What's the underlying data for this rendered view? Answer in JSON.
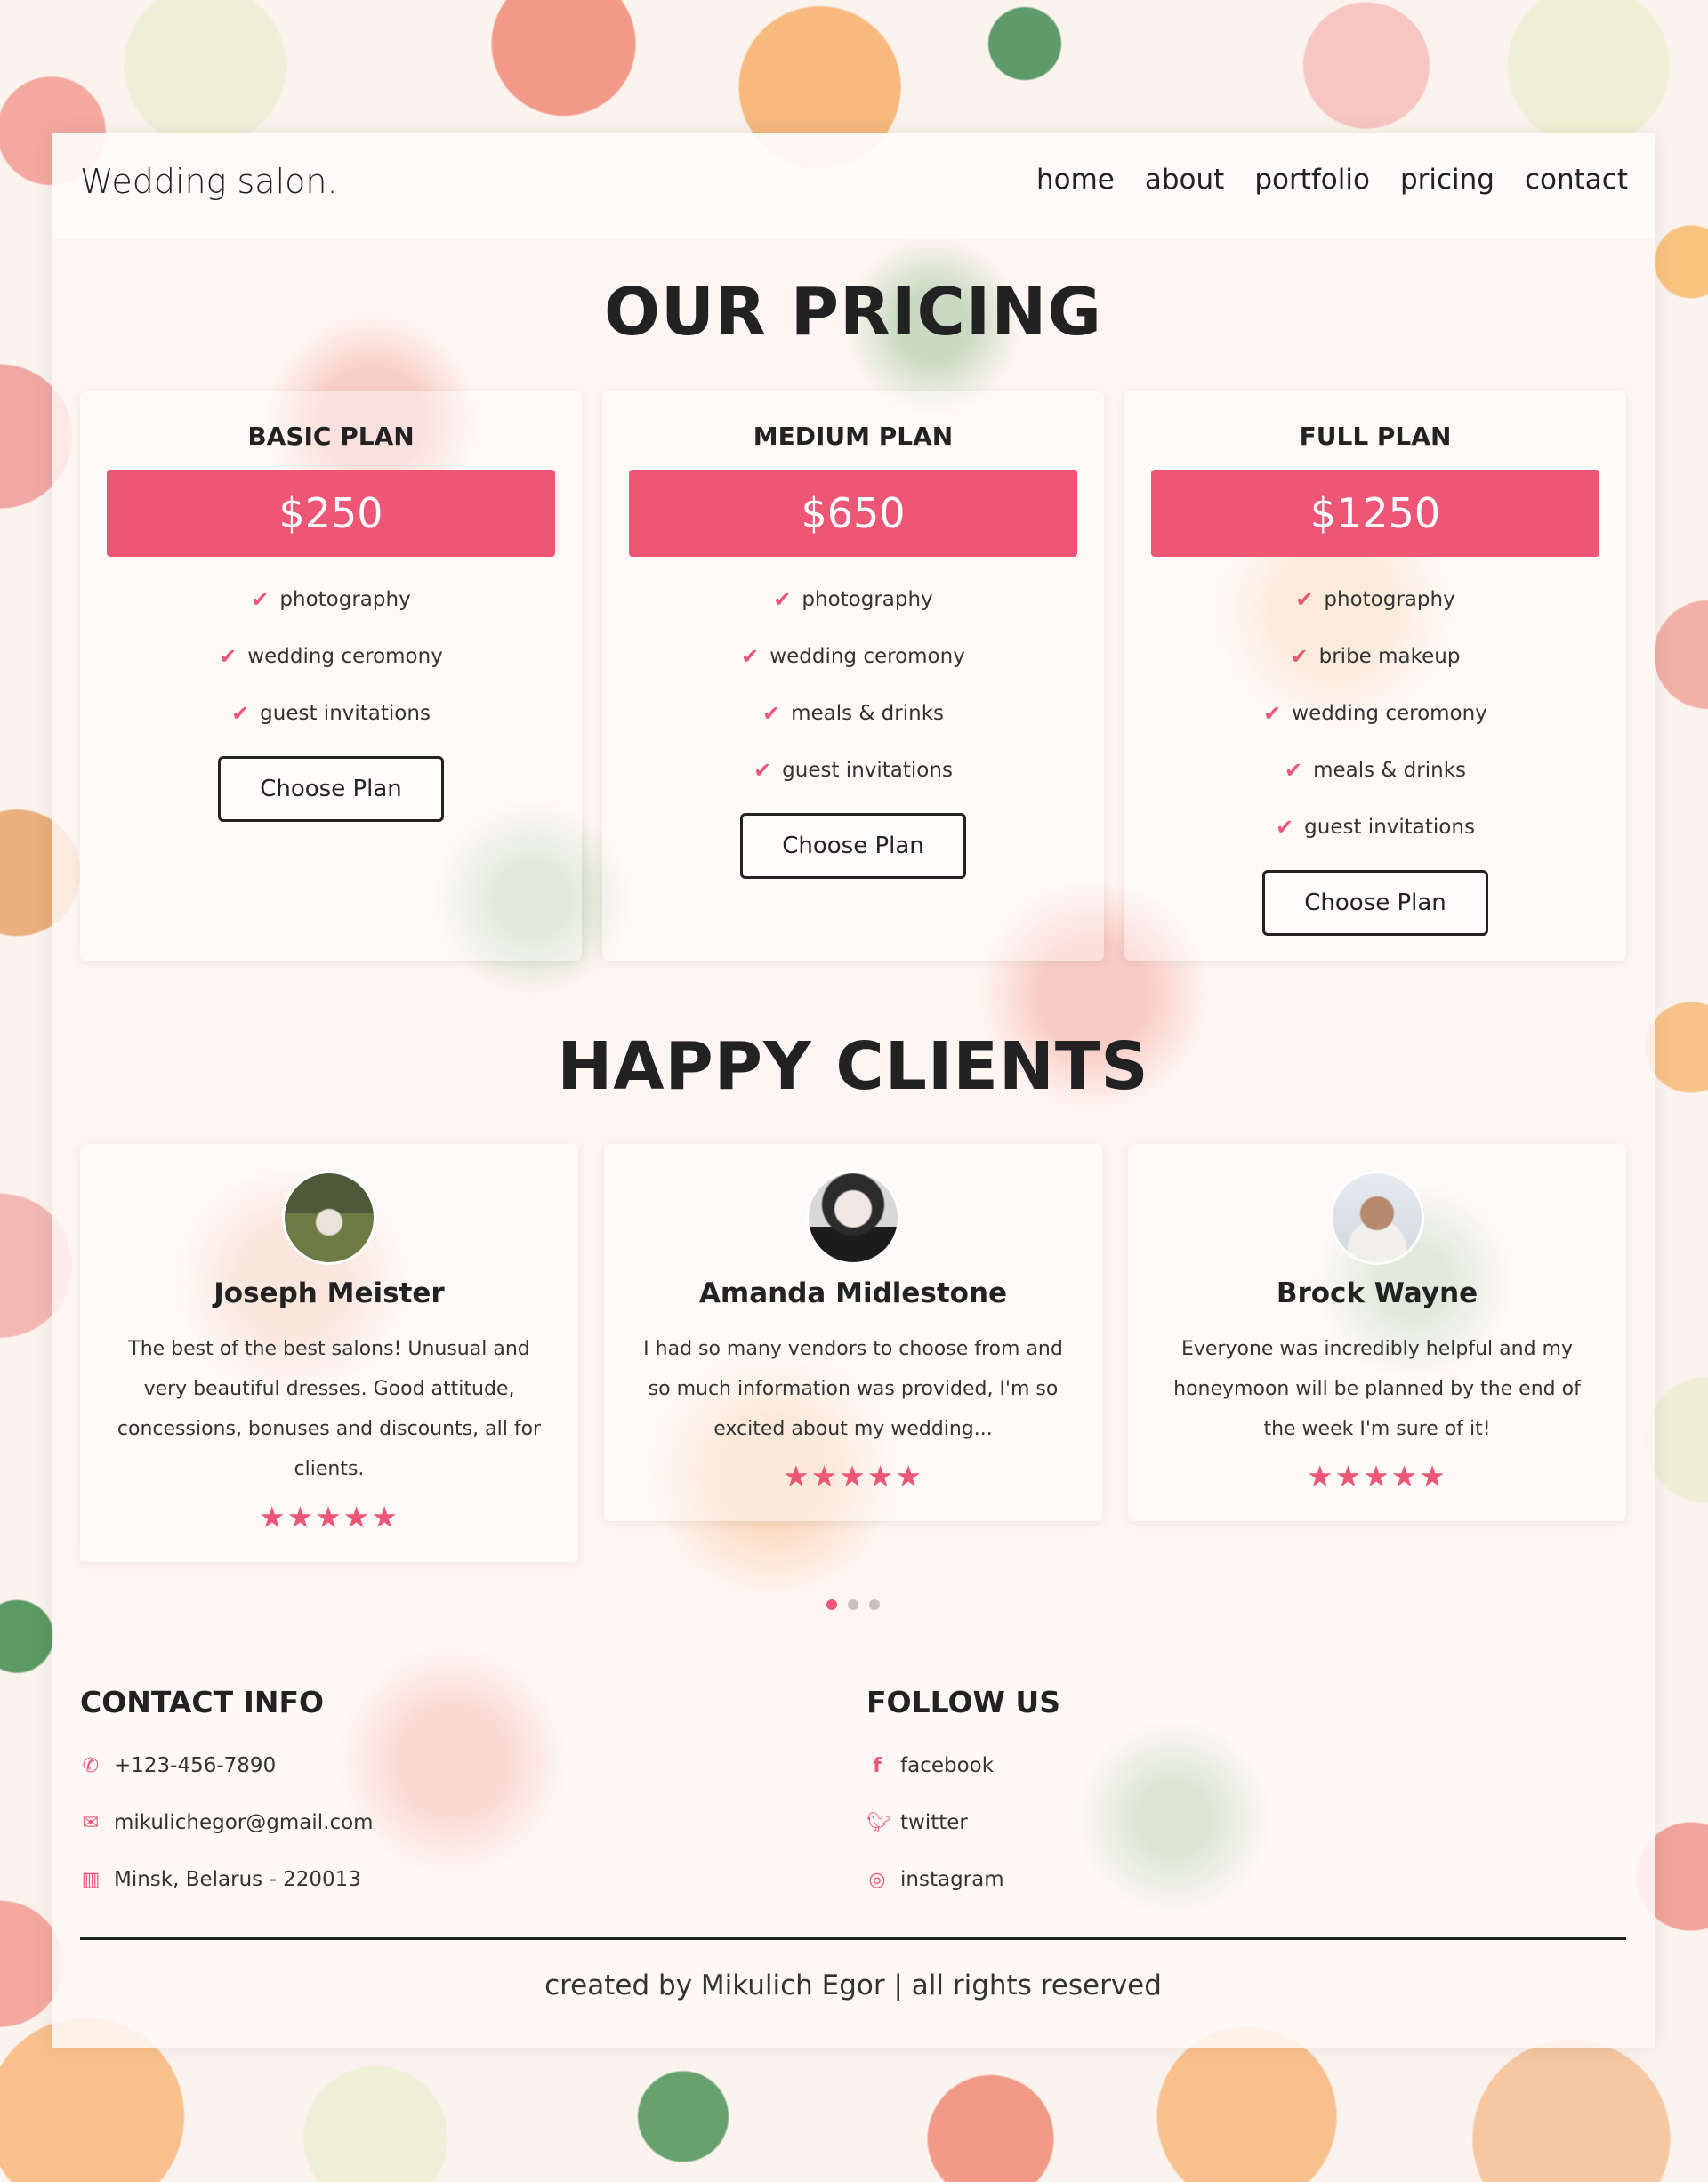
{
  "brand": "Wedding salon.",
  "nav": [
    "home",
    "about",
    "portfolio",
    "pricing",
    "contact"
  ],
  "pricing": {
    "title": "OUR PRICING",
    "plans": [
      {
        "name": "BASIC PLAN",
        "price": "$250",
        "features": [
          "photography",
          "wedding ceromony",
          "guest invitations"
        ],
        "button": "Choose Plan"
      },
      {
        "name": "MEDIUM PLAN",
        "price": "$650",
        "features": [
          "photography",
          "wedding ceromony",
          "meals & drinks",
          "guest invitations"
        ],
        "button": "Choose Plan"
      },
      {
        "name": "FULL PLAN",
        "price": "$1250",
        "features": [
          "photography",
          "bribe makeup",
          "wedding ceromony",
          "meals & drinks",
          "guest invitations"
        ],
        "button": "Choose Plan"
      }
    ]
  },
  "clients": {
    "title": "HAPPY CLIENTS",
    "items": [
      {
        "name": "Joseph Meister",
        "text": "The best of the best salons! Unusual and very beautiful dresses. Good attitude, concessions, bonuses and discounts, all for clients.",
        "rating": 5
      },
      {
        "name": "Amanda Midlestone",
        "text": "I had so many vendors to choose from and so much information was provided, I'm so excited about my wedding...",
        "rating": 5
      },
      {
        "name": "Brock Wayne",
        "text": "Everyone was incredibly helpful and my honeymoon will be planned by the end of the week I'm sure of it!",
        "rating": 5
      }
    ],
    "slider_total": 3,
    "slider_active": 1
  },
  "footer": {
    "contact_title": "CONTACT INFO",
    "contact": [
      {
        "icon": "phone-icon",
        "text": "+123-456-7890"
      },
      {
        "icon": "envelope-icon",
        "text": "mikulichegor@gmail.com"
      },
      {
        "icon": "map-icon",
        "text": "Minsk, Belarus - 220013"
      }
    ],
    "follow_title": "FOLLOW US",
    "social": [
      {
        "icon": "facebook-icon",
        "text": "facebook"
      },
      {
        "icon": "twitter-icon",
        "text": "twitter"
      },
      {
        "icon": "instagram-icon",
        "text": "instagram"
      }
    ],
    "credit": "created by Mikulich Egor | all rights reserved"
  },
  "colors": {
    "accent": "#ee5676",
    "text": "#222222"
  }
}
